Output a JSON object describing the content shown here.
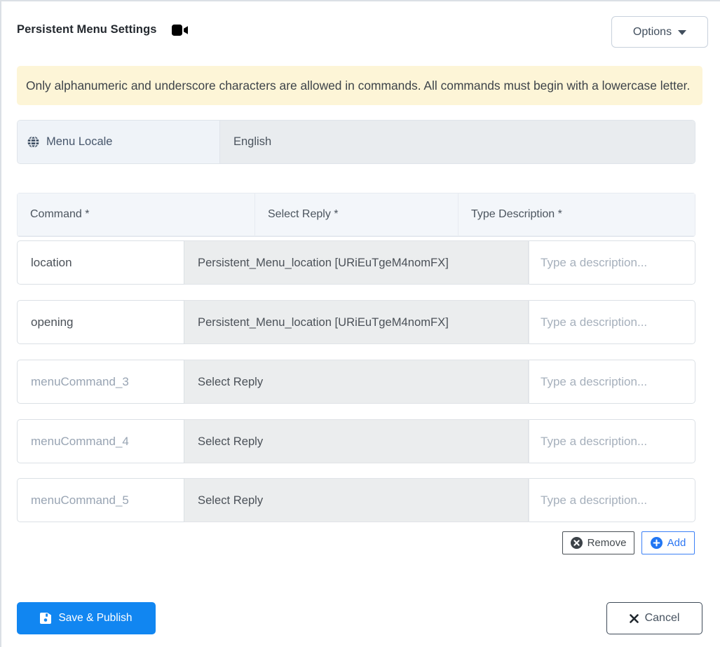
{
  "panel": {
    "title": "Persistent Menu Settings"
  },
  "options_button": {
    "label": "Options"
  },
  "alert": {
    "text": "Only alphanumeric and underscore characters are allowed in commands. All commands must begin with a lowercase letter."
  },
  "locale": {
    "label": "Menu Locale",
    "value": "English"
  },
  "table": {
    "headers": [
      "Command *",
      "Select Reply *",
      "Type Description *"
    ],
    "rows": [
      {
        "command": "location",
        "command_placeholder": "",
        "reply": "Persistent_Menu_location [URiEuTgeM4nomFX]",
        "description_placeholder": "Type a description..."
      },
      {
        "command": "opening",
        "command_placeholder": "",
        "reply": "Persistent_Menu_location [URiEuTgeM4nomFX]",
        "description_placeholder": "Type a description..."
      },
      {
        "command": "",
        "command_placeholder": "menuCommand_3",
        "reply": "Select Reply",
        "description_placeholder": "Type a description..."
      },
      {
        "command": "",
        "command_placeholder": "menuCommand_4",
        "reply": "Select Reply",
        "description_placeholder": "Type a description..."
      },
      {
        "command": "",
        "command_placeholder": "menuCommand_5",
        "reply": "Select Reply",
        "description_placeholder": "Type a description..."
      }
    ]
  },
  "row_actions": {
    "remove_label": "Remove",
    "add_label": "Add"
  },
  "footer": {
    "save_label": "Save & Publish",
    "cancel_label": "Cancel"
  },
  "colors": {
    "primary_blue": "#1186f1",
    "alert_background": "#fdf5d7",
    "header_cell_background": "#f3f6fa",
    "reply_cell_background": "#ebedee"
  }
}
